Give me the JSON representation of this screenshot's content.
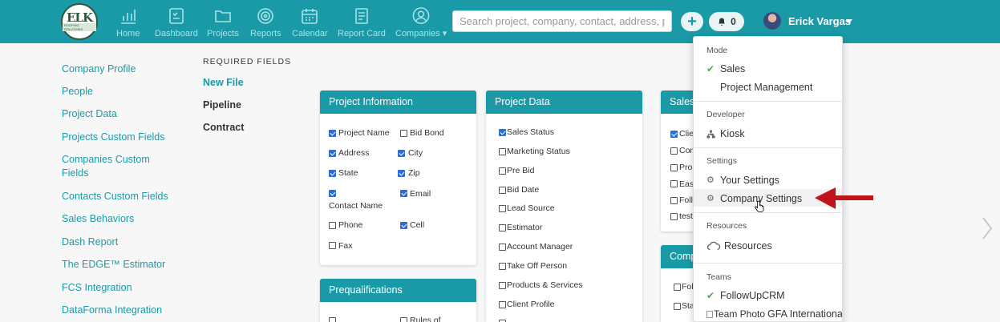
{
  "logo": {
    "line1": "ELK",
    "line2": "ROOFING SOLUTIONS"
  },
  "nav": [
    {
      "name": "nav-home",
      "label": "Home",
      "icon": "bar-chart-icon"
    },
    {
      "name": "nav-dashboard",
      "label": "Dashboard",
      "icon": "checklist-icon"
    },
    {
      "name": "nav-projects",
      "label": "Projects",
      "icon": "folder-icon"
    },
    {
      "name": "nav-reports",
      "label": "Reports",
      "icon": "target-icon"
    },
    {
      "name": "nav-calendar",
      "label": "Calendar",
      "icon": "calendar-icon"
    },
    {
      "name": "nav-report-card",
      "label": "Report Card",
      "icon": "document-icon"
    },
    {
      "name": "nav-companies",
      "label": "Companies ▾",
      "icon": "person-circle-icon"
    }
  ],
  "search": {
    "placeholder": "Search project, company, contact, address, phone"
  },
  "notifications": {
    "count": "0"
  },
  "user": {
    "name": "Erick Vargas"
  },
  "left_menu": [
    {
      "label": "Company Profile"
    },
    {
      "label": "People"
    },
    {
      "label": "Project Data"
    },
    {
      "label": "Projects Custom Fields"
    },
    {
      "label": "Companies Custom Fields"
    },
    {
      "label": "Contacts Custom Fields"
    },
    {
      "label": "Sales Behaviors"
    },
    {
      "label": "Dash Report"
    },
    {
      "label": "The EDGE™ Estimator"
    },
    {
      "label": "FCS Integration"
    },
    {
      "label": "DataForma Integration"
    }
  ],
  "required_fields": {
    "heading": "REQUIRED FIELDS",
    "links": [
      {
        "label": "New File",
        "active": true
      },
      {
        "label": "Pipeline",
        "active": false
      },
      {
        "label": "Contract",
        "active": false
      }
    ]
  },
  "project_information": {
    "title": "Project Information",
    "fields": [
      {
        "label": "Project Name",
        "checked": true
      },
      {
        "label": "Bid Bond",
        "checked": false
      },
      {
        "label": "Address",
        "checked": true
      },
      {
        "label": "City",
        "checked": true
      },
      {
        "label": "State",
        "checked": true
      },
      {
        "label": "Zip",
        "checked": true
      },
      {
        "label": "Contact Name",
        "checked": true
      },
      {
        "label": "Email",
        "checked": true
      },
      {
        "label": "Phone",
        "checked": false
      },
      {
        "label": "Cell",
        "checked": true
      },
      {
        "label": "Fax",
        "checked": false
      }
    ]
  },
  "prequalifications": {
    "title": "Prequalifications",
    "fields": [
      {
        "label": "",
        "checked": false
      },
      {
        "label": "Rules of",
        "checked": false
      }
    ]
  },
  "project_data": {
    "title": "Project Data",
    "fields": [
      {
        "label": "Sales Status",
        "checked": true
      },
      {
        "label": "Marketing Status",
        "checked": false
      },
      {
        "label": "Pre Bid",
        "checked": false
      },
      {
        "label": "Bid Date",
        "checked": false
      },
      {
        "label": "Lead Source",
        "checked": false
      },
      {
        "label": "Estimator",
        "checked": false
      },
      {
        "label": "Account Manager",
        "checked": false
      },
      {
        "label": "Take Off Person",
        "checked": false
      },
      {
        "label": "Products & Services",
        "checked": false
      },
      {
        "label": "Client Profile",
        "checked": false
      }
    ]
  },
  "sales_card": {
    "title": "Sales",
    "fields": [
      {
        "label": "Clie",
        "checked": true
      },
      {
        "label": "Con",
        "checked": false
      },
      {
        "label": "Prop",
        "checked": false
      },
      {
        "label": "Eas",
        "checked": false
      },
      {
        "label": "Foll",
        "checked": false
      },
      {
        "label": "test",
        "checked": false
      }
    ]
  },
  "comp_card": {
    "title": "Comp",
    "fields": [
      {
        "label": "Fol",
        "checked": false
      },
      {
        "label": "Sta",
        "checked": false
      }
    ]
  },
  "dropdown": {
    "mode_label": "Mode",
    "mode_sales": "Sales",
    "mode_pm": "Project Management",
    "developer_label": "Developer",
    "kiosk": "Kiosk",
    "settings_label": "Settings",
    "your_settings": "Your Settings",
    "company_settings": "Company Settings",
    "resources_label": "Resources",
    "resources": "Resources",
    "teams_label": "Teams",
    "team_followup": "FollowUpCRM",
    "team_photo_alt": "Team Photo",
    "team_gfa": "GFA International"
  },
  "colors": {
    "brand": "#1a9aa6",
    "annotation_arrow": "#c0131a",
    "check_green": "#4cae4c"
  }
}
